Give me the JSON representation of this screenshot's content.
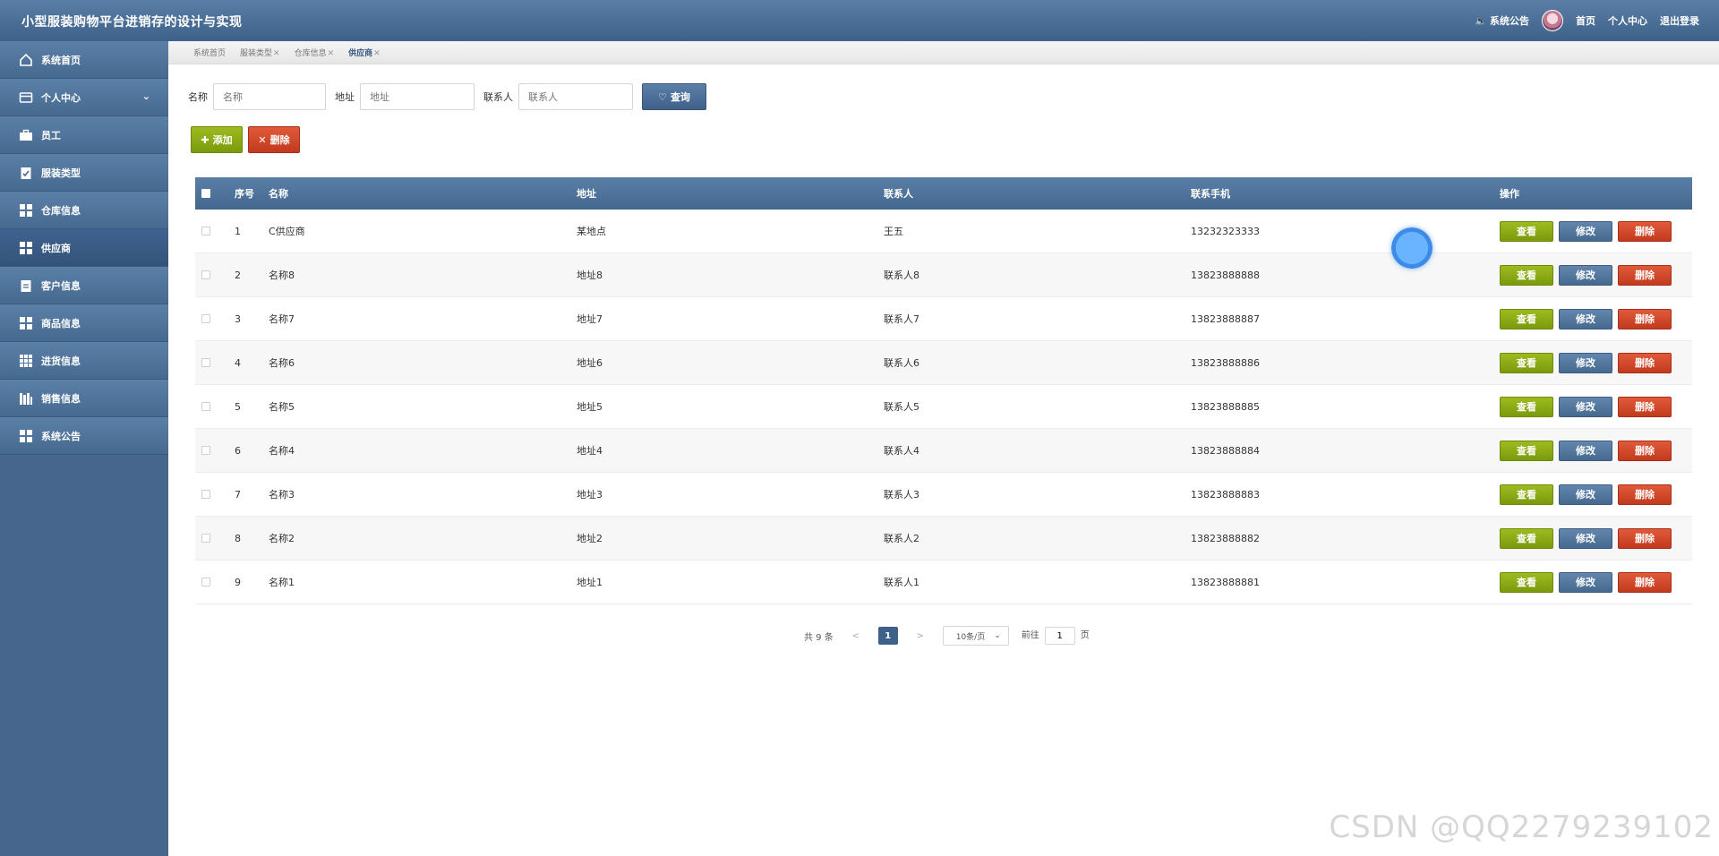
{
  "app": {
    "title": "小型服装购物平台进销存的设计与实现"
  },
  "header": {
    "notice": "系统公告",
    "home": "首页",
    "profile": "个人中心",
    "logout": "退出登录"
  },
  "sidebar": {
    "items": [
      {
        "label": "系统首页",
        "icon": "home-icon"
      },
      {
        "label": "个人中心",
        "icon": "card-icon",
        "expandable": true
      },
      {
        "label": "员工",
        "icon": "briefcase-icon"
      },
      {
        "label": "服装类型",
        "icon": "clipboard-check-icon"
      },
      {
        "label": "仓库信息",
        "icon": "grid-icon"
      },
      {
        "label": "供应商",
        "icon": "grid-icon",
        "active": true
      },
      {
        "label": "客户信息",
        "icon": "clipboard-icon"
      },
      {
        "label": "商品信息",
        "icon": "grid-icon"
      },
      {
        "label": "进货信息",
        "icon": "apps-icon"
      },
      {
        "label": "销售信息",
        "icon": "books-icon"
      },
      {
        "label": "系统公告",
        "icon": "grid-icon"
      }
    ]
  },
  "tabs": [
    {
      "label": "系统首页",
      "closable": false
    },
    {
      "label": "服装类型",
      "closable": true
    },
    {
      "label": "仓库信息",
      "closable": true
    },
    {
      "label": "供应商",
      "closable": true,
      "current": true
    }
  ],
  "search": {
    "name_label": "名称",
    "name_placeholder": "名称",
    "addr_label": "地址",
    "addr_placeholder": "地址",
    "contact_label": "联系人",
    "contact_placeholder": "联系人",
    "query_label": "查询"
  },
  "toolbar": {
    "add_label": "添加",
    "delete_label": "删除"
  },
  "table": {
    "headers": {
      "no": "序号",
      "name": "名称",
      "addr": "地址",
      "contact": "联系人",
      "phone": "联系手机",
      "op": "操作"
    },
    "op_labels": {
      "view": "查看",
      "edit": "修改",
      "delete": "删除"
    },
    "rows": [
      {
        "no": "1",
        "name": "C供应商",
        "addr": "某地点",
        "contact": "王五",
        "phone": "13232323333"
      },
      {
        "no": "2",
        "name": "名称8",
        "addr": "地址8",
        "contact": "联系人8",
        "phone": "13823888888"
      },
      {
        "no": "3",
        "name": "名称7",
        "addr": "地址7",
        "contact": "联系人7",
        "phone": "13823888887"
      },
      {
        "no": "4",
        "name": "名称6",
        "addr": "地址6",
        "contact": "联系人6",
        "phone": "13823888886"
      },
      {
        "no": "5",
        "name": "名称5",
        "addr": "地址5",
        "contact": "联系人5",
        "phone": "13823888885"
      },
      {
        "no": "6",
        "name": "名称4",
        "addr": "地址4",
        "contact": "联系人4",
        "phone": "13823888884"
      },
      {
        "no": "7",
        "name": "名称3",
        "addr": "地址3",
        "contact": "联系人3",
        "phone": "13823888883"
      },
      {
        "no": "8",
        "name": "名称2",
        "addr": "地址2",
        "contact": "联系人2",
        "phone": "13823888882"
      },
      {
        "no": "9",
        "name": "名称1",
        "addr": "地址1",
        "contact": "联系人1",
        "phone": "13823888881"
      }
    ]
  },
  "pagination": {
    "total": "共 9 条",
    "prev": "<",
    "current_page": "1",
    "next": ">",
    "page_size": "10条/页",
    "goto_prefix": "前往",
    "goto_value": "1",
    "goto_suffix": "页"
  },
  "watermark": "CSDN @QQ2279239102",
  "colors": {
    "primary": "#46698f",
    "green": "#8aab15",
    "red": "#d0482a"
  }
}
